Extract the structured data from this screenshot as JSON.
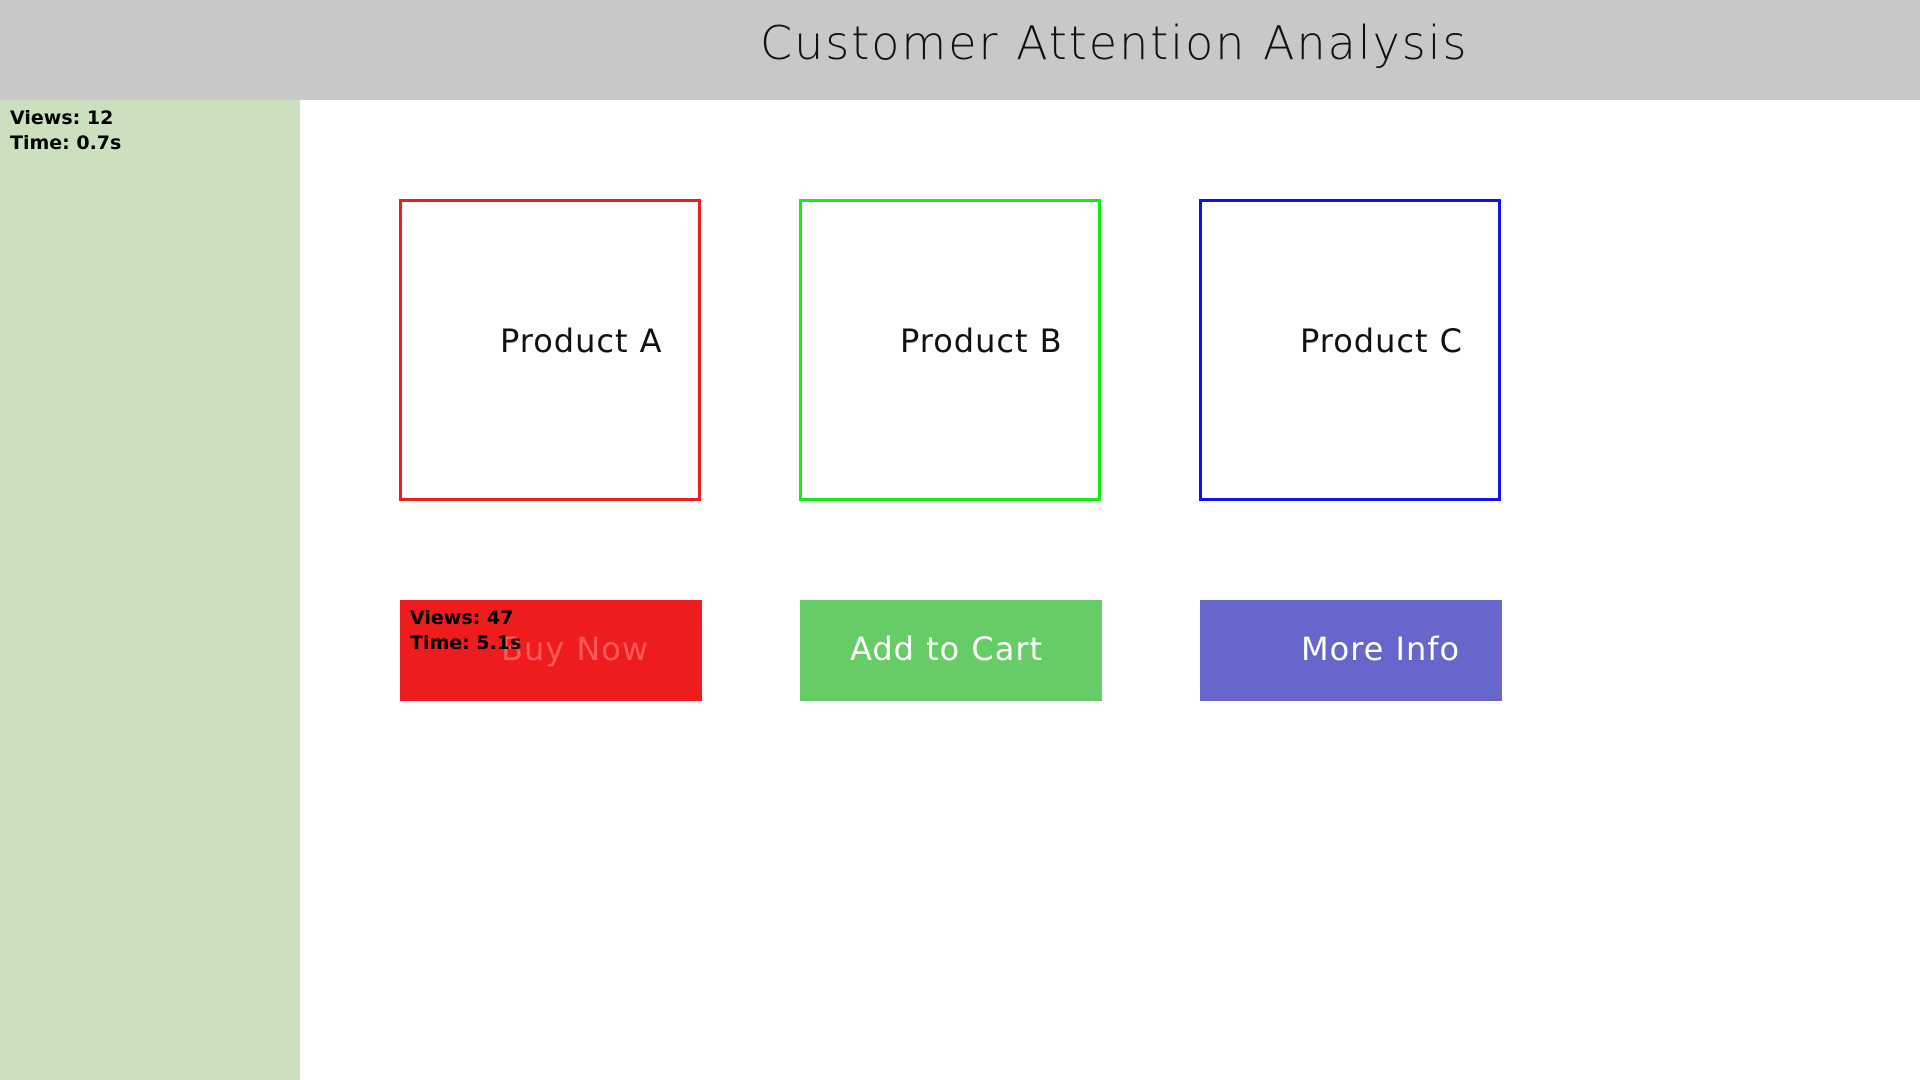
{
  "header": {
    "title": "Customer Attention Analysis"
  },
  "sidebar_stats": {
    "views": "Views: 12",
    "time": "Time: 0.7s"
  },
  "products": [
    {
      "label": "Product A",
      "border_color": "#ee1c1c"
    },
    {
      "label": "Product B",
      "border_color": "#11ee11"
    },
    {
      "label": "Product C",
      "border_color": "#1111ee"
    }
  ],
  "buttons": [
    {
      "label": "Buy Now",
      "color": "#ee1c1c"
    },
    {
      "label": "Add to Cart",
      "color": "#66cc66"
    },
    {
      "label": "More Info",
      "color": "#6666cc"
    }
  ],
  "buy_now_stats": {
    "views": "Views: 47",
    "time": "Time: 5.1s"
  },
  "colors": {
    "header_bg": "#c8c8c8",
    "sidebar_bg": "#cce0c0"
  }
}
